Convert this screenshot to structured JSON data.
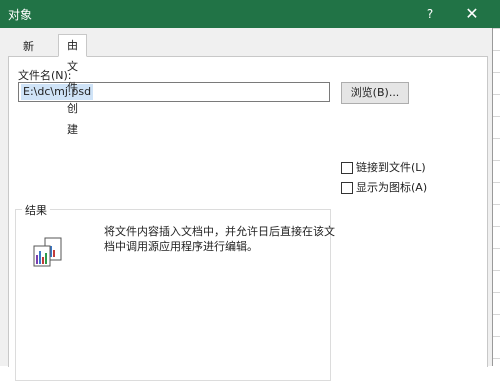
{
  "window": {
    "title": "对象",
    "help_label": "?",
    "close_label": "✕"
  },
  "tabs": [
    {
      "label": "新建"
    },
    {
      "label": "由文件创建"
    }
  ],
  "filename": {
    "label": "文件名(N):",
    "value": "E:\\dc\\mj.psd"
  },
  "browse_label": "浏览(B)...",
  "options": {
    "link_label": "链接到文件(L)",
    "icon_label": "显示为图标(A)"
  },
  "result": {
    "title": "结果",
    "text": "将文件内容插入文档中，并允许日后直接在该文档中调用源应用程序进行编辑。"
  },
  "icons": {
    "help": "help-icon",
    "close": "close-icon",
    "result": "embedded-object-icon"
  },
  "colors": {
    "titlebar": "#217346",
    "selection": "#cfe3f7"
  }
}
